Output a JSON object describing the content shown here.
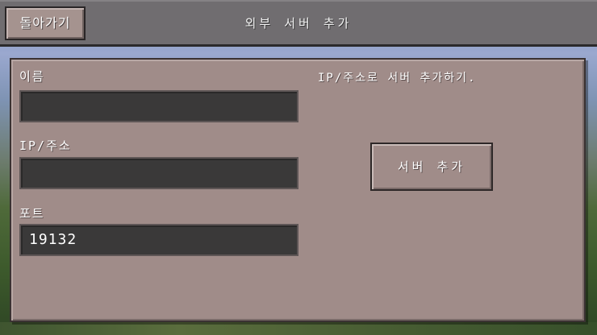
{
  "header": {
    "back_label": "돌아가기",
    "title": "외부 서버 추가"
  },
  "form": {
    "name": {
      "label": "이름",
      "value": ""
    },
    "address": {
      "label": "IP/주소",
      "value": ""
    },
    "port": {
      "label": "포트",
      "value": "19132"
    }
  },
  "side": {
    "hint": "IP/주소로 서버 추가하기.",
    "add_label": "서버 추가"
  },
  "colors": {
    "panel": "#a08c89",
    "field": "#3a3939",
    "topbar": "#706d70"
  }
}
